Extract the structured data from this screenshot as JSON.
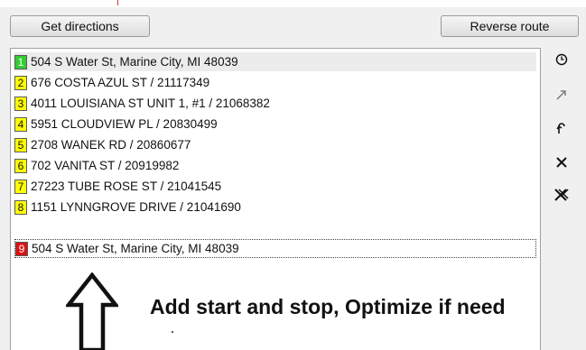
{
  "toolbar": {
    "get_directions_label": "Get directions",
    "reverse_route_label": "Reverse route"
  },
  "route": {
    "stops": [
      {
        "number": "1",
        "text": "504 S Water St, Marine City, MI 48039",
        "color": "#33cc33"
      },
      {
        "number": "2",
        "text": "676 COSTA AZUL ST / 21117349",
        "color": "#ffff00"
      },
      {
        "number": "3",
        "text": "4011 LOUISIANA ST UNIT 1, #1 / 21068382",
        "color": "#ffff00"
      },
      {
        "number": "4",
        "text": "5951 CLOUDVIEW PL / 20830499",
        "color": "#ffff00"
      },
      {
        "number": "5",
        "text": "2708 WANEK RD / 20860677",
        "color": "#ffff00"
      },
      {
        "number": "6",
        "text": "702 VANITA ST / 20919982",
        "color": "#ffff00"
      },
      {
        "number": "7",
        "text": "27223 TUBE ROSE ST / 21041545",
        "color": "#ffff00"
      },
      {
        "number": "8",
        "text": "1151 LYNNGROVE DRIVE / 21041690",
        "color": "#ffff00"
      },
      {
        "number": "9",
        "text": "504 S Water St, Marine City, MI 48039",
        "color": "#dd1111"
      }
    ]
  },
  "side_tools": [
    {
      "icon": "clock-icon"
    },
    {
      "icon": "optimize-arrow-icon"
    },
    {
      "icon": "return-arrow-icon"
    },
    {
      "icon": "delete-x-icon"
    },
    {
      "icon": "delete-all-icon"
    }
  ],
  "annotation": {
    "text": "Add start and stop, Optimize if need"
  }
}
